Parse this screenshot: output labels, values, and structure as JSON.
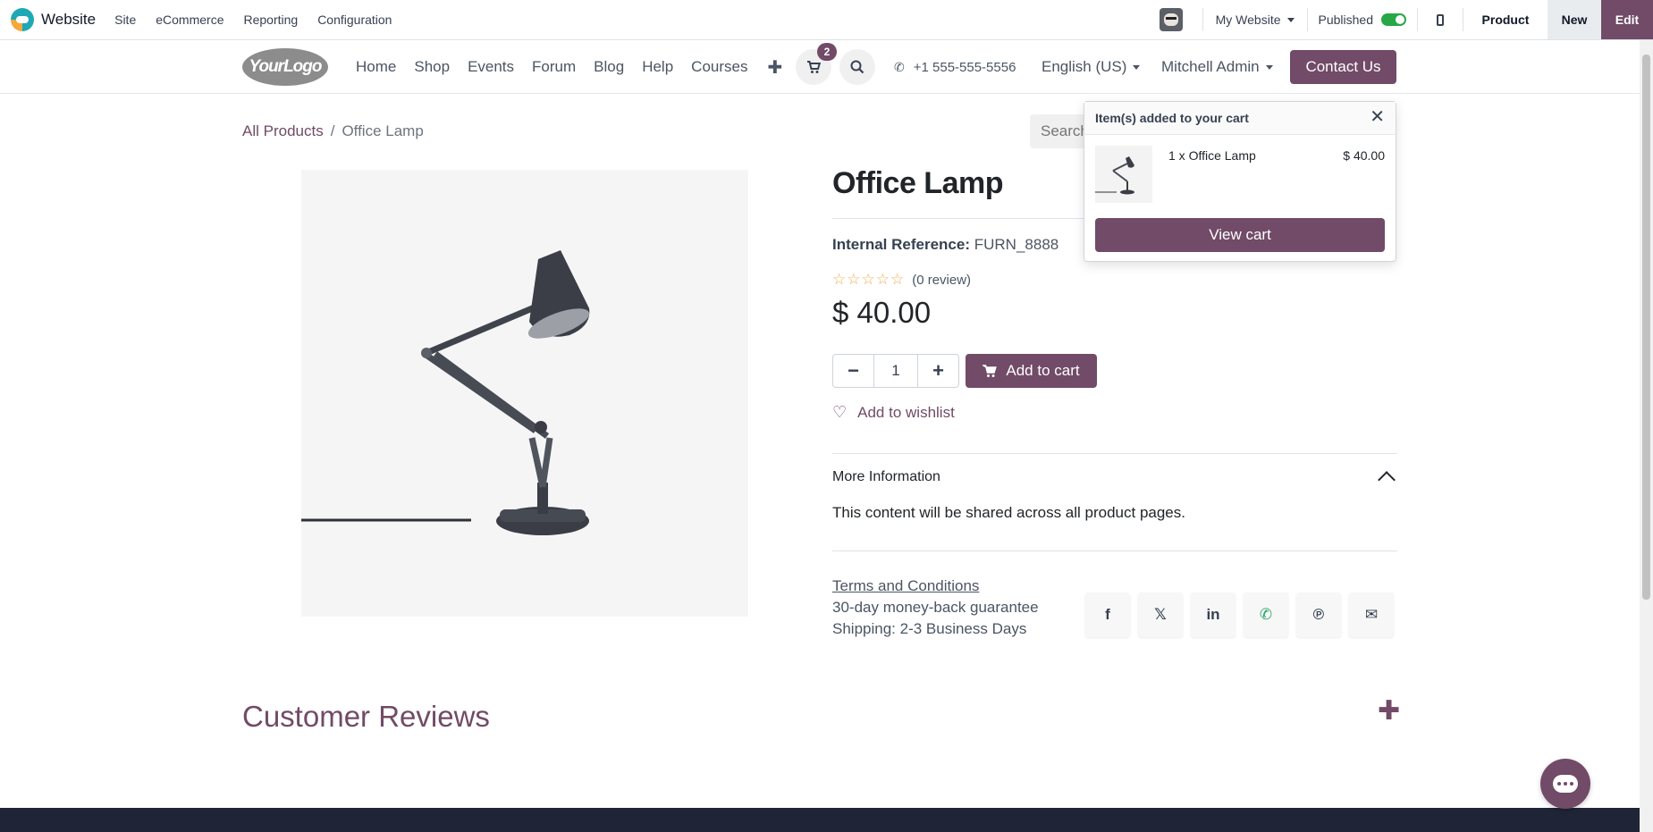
{
  "adminbar": {
    "app_name": "Website",
    "menu": [
      "Site",
      "eCommerce",
      "Reporting",
      "Configuration"
    ],
    "my_website": "My Website",
    "published_label": "Published",
    "published": true,
    "product_label": "Product",
    "new_label": "New",
    "edit_label": "Edit"
  },
  "sitenav": {
    "logo_text": "YourLogo",
    "links": [
      "Home",
      "Shop",
      "Events",
      "Forum",
      "Blog",
      "Help",
      "Courses"
    ],
    "cart_count": "2",
    "phone": "+1 555-555-5556",
    "language": "English (US)",
    "user": "Mitchell Admin",
    "contact_label": "Contact Us"
  },
  "breadcrumb": {
    "root": "All Products",
    "current": "Office Lamp"
  },
  "search": {
    "placeholder": "Search"
  },
  "product": {
    "title": "Office Lamp",
    "internal_ref_label": "Internal Reference:",
    "internal_ref_value": "FURN_8888",
    "stars": "☆☆☆☆☆",
    "review_text": "(0 review)",
    "price": "$ 40.00",
    "quantity": "1",
    "add_to_cart_label": "Add to cart",
    "wishlist_label": "Add to wishlist",
    "more_info_label": "More Information",
    "shared_text": "This content will be shared across all product pages.",
    "terms_label": "Terms and Conditions",
    "guarantee": "30-day money-back guarantee",
    "shipping": "Shipping: 2-3 Business Days",
    "social_icons": [
      "facebook-icon",
      "x-icon",
      "linkedin-icon",
      "whatsapp-icon",
      "pinterest-icon",
      "email-icon"
    ]
  },
  "reviews": {
    "title": "Customer Reviews"
  },
  "cart_popover": {
    "title": "Item(s) added to your cart",
    "line_text": "1 x Office Lamp",
    "line_price": "$ 40.00",
    "view_cart_label": "View cart"
  },
  "colors": {
    "brand": "#714b67",
    "toggle_on": "#28a745",
    "footer": "#1f2536",
    "star": "#f0ad4e"
  }
}
